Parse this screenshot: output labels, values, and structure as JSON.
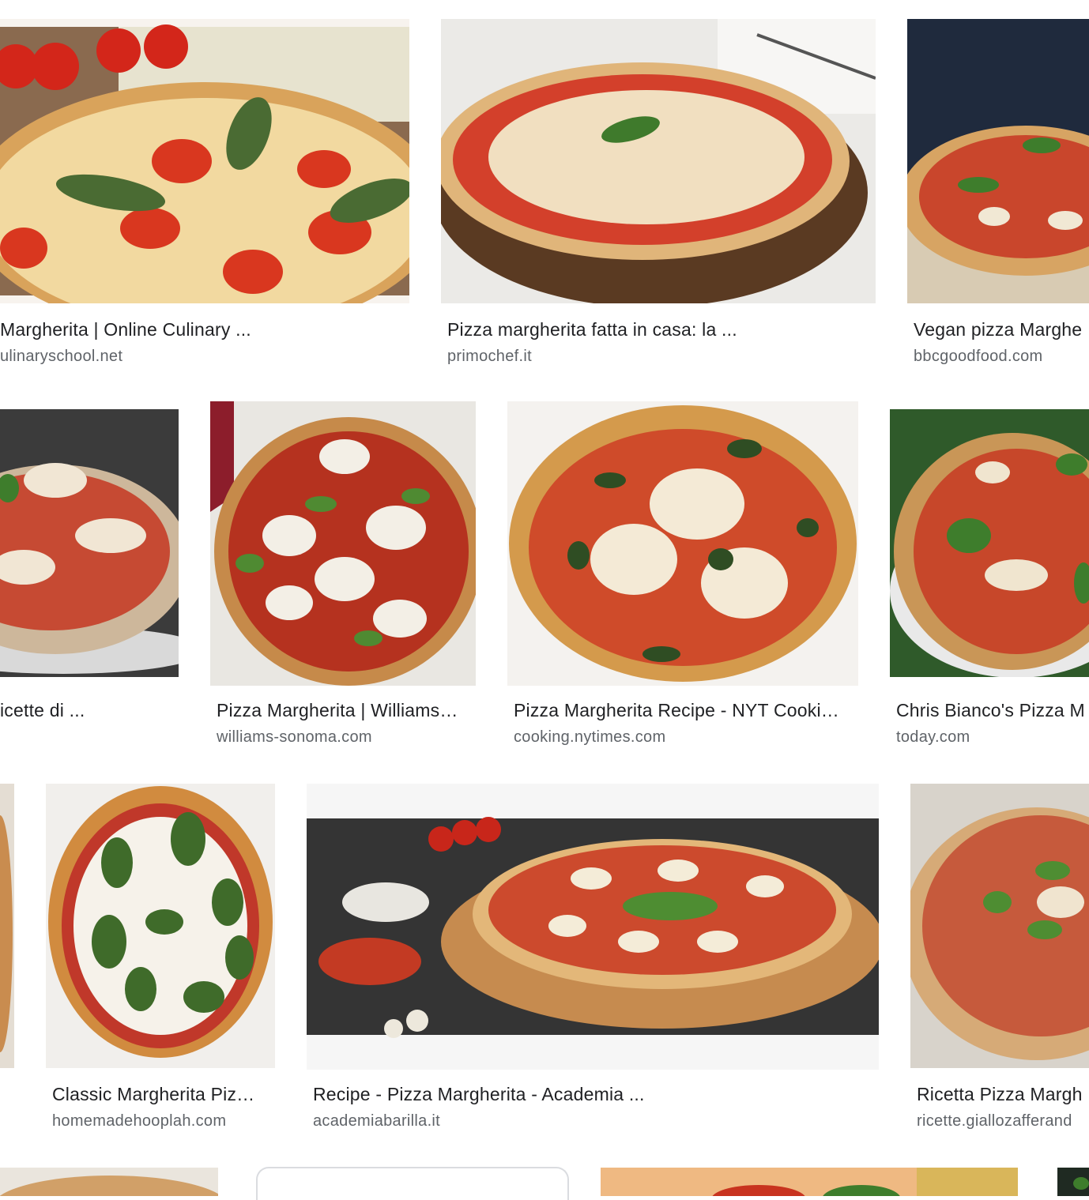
{
  "results": [
    {
      "title": "Margherita | Online Culinary ...",
      "source": "ulinaryschool.net",
      "thumb_icon": "pizza-tomatoes-basil-image"
    },
    {
      "title": "Pizza margherita fatta in casa: la ...",
      "source": "primochef.it",
      "thumb_icon": "pizza-wooden-board-image"
    },
    {
      "title": "Vegan pizza Marghe",
      "source": "bbcgoodfood.com",
      "thumb_icon": "vegan-pizza-image"
    },
    {
      "title": "icette di ...",
      "source": "",
      "thumb_icon": "pizza-slice-image"
    },
    {
      "title": "Pizza Margherita | Williams…",
      "source": "williams-sonoma.com",
      "thumb_icon": "pizza-mozzarella-image"
    },
    {
      "title": "Pizza Margherita Recipe - NYT Cooki…",
      "source": "cooking.nytimes.com",
      "thumb_icon": "pizza-charred-image"
    },
    {
      "title": "Chris Bianco's Pizza M",
      "source": "today.com",
      "thumb_icon": "pizza-plate-image"
    },
    {
      "title": "Classic Margherita Piz…",
      "source": "homemadehooplah.com",
      "thumb_icon": "pizza-classic-image"
    },
    {
      "title": "Recipe - Pizza Margherita - Academia ...",
      "source": "academiabarilla.it",
      "thumb_icon": "pizza-board-ingredients-image"
    },
    {
      "title": "Ricetta Pizza Margh",
      "source": "ricette.giallozafferand",
      "thumb_icon": "pizza-rustic-image"
    }
  ],
  "colors": {
    "title": "#202124",
    "source": "#5f6368",
    "crust": "#d9a35b",
    "sauce": "#c8331f",
    "cheese": "#f4ecd6",
    "basil": "#3f6b2a"
  }
}
